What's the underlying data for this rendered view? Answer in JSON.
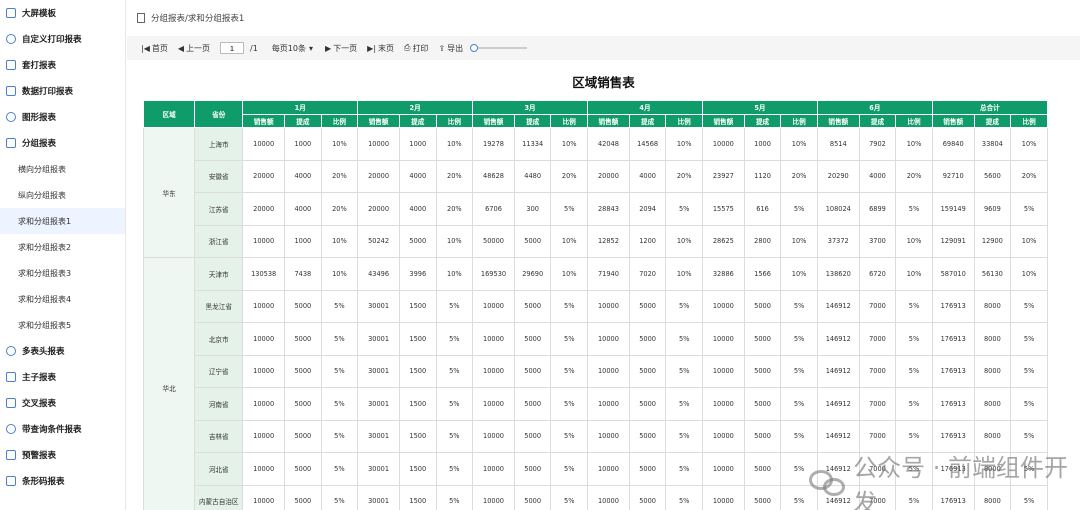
{
  "sidebar": {
    "items": [
      {
        "label": "大屏模板",
        "type": "top"
      },
      {
        "label": "自定义打印报表",
        "type": "top"
      },
      {
        "label": "套打报表",
        "type": "top"
      },
      {
        "label": "数据打印报表",
        "type": "top"
      },
      {
        "label": "图形报表",
        "type": "top"
      },
      {
        "label": "分组报表",
        "type": "top"
      },
      {
        "label": "横向分组报表",
        "type": "sub"
      },
      {
        "label": "纵向分组报表",
        "type": "sub"
      },
      {
        "label": "求和分组报表1",
        "type": "sub",
        "active": true
      },
      {
        "label": "求和分组报表2",
        "type": "sub"
      },
      {
        "label": "求和分组报表3",
        "type": "sub"
      },
      {
        "label": "求和分组报表4",
        "type": "sub"
      },
      {
        "label": "求和分组报表5",
        "type": "sub"
      },
      {
        "label": "多表头报表",
        "type": "top"
      },
      {
        "label": "主子报表",
        "type": "top"
      },
      {
        "label": "交叉报表",
        "type": "top"
      },
      {
        "label": "带查询条件报表",
        "type": "top"
      },
      {
        "label": "预警报表",
        "type": "top"
      },
      {
        "label": "条形码报表",
        "type": "top"
      }
    ]
  },
  "breadcrumb": "分组报表/求和分组报表1",
  "toolbar": {
    "first": "首页",
    "prev": "上一页",
    "page_value": "1",
    "total": "/1",
    "per_page": "每页10条",
    "next": "下一页",
    "last": "末页",
    "print": "打印",
    "export": "导出"
  },
  "report": {
    "title": "区域销售表",
    "col_region": "区域",
    "col_province": "省份",
    "months": [
      "1月",
      "2月",
      "3月",
      "4月",
      "5月",
      "6月",
      "总合计"
    ],
    "sub_headers": [
      "销售额",
      "提成",
      "比例"
    ],
    "groups": [
      {
        "region": "华东",
        "rows": [
          {
            "province": "上海市",
            "cells": [
              "10000",
              "1000",
              "10%",
              "10000",
              "1000",
              "10%",
              "19278",
              "11334",
              "10%",
              "42048",
              "14568",
              "10%",
              "10000",
              "1000",
              "10%",
              "8514",
              "7902",
              "10%",
              "69840",
              "33804",
              "10%"
            ]
          },
          {
            "province": "安徽省",
            "cells": [
              "20000",
              "4000",
              "20%",
              "20000",
              "4000",
              "20%",
              "48628",
              "4480",
              "20%",
              "20000",
              "4000",
              "20%",
              "23927",
              "1120",
              "20%",
              "20290",
              "4000",
              "20%",
              "92710",
              "5600",
              "20%"
            ]
          },
          {
            "province": "江苏省",
            "cells": [
              "20000",
              "4000",
              "20%",
              "20000",
              "4000",
              "20%",
              "6706",
              "300",
              "5%",
              "28843",
              "2094",
              "5%",
              "15575",
              "616",
              "5%",
              "108024",
              "6899",
              "5%",
              "159149",
              "9609",
              "5%"
            ]
          },
          {
            "province": "浙江省",
            "cells": [
              "10000",
              "1000",
              "10%",
              "50242",
              "5000",
              "10%",
              "50000",
              "5000",
              "10%",
              "12852",
              "1200",
              "10%",
              "28625",
              "2800",
              "10%",
              "37372",
              "3700",
              "10%",
              "129091",
              "12900",
              "10%"
            ]
          }
        ]
      },
      {
        "region": "华北",
        "rows": [
          {
            "province": "天津市",
            "cells": [
              "130538",
              "7438",
              "10%",
              "43496",
              "3996",
              "10%",
              "169530",
              "29690",
              "10%",
              "71940",
              "7020",
              "10%",
              "32886",
              "1566",
              "10%",
              "138620",
              "6720",
              "10%",
              "587010",
              "56130",
              "10%"
            ]
          },
          {
            "province": "黑龙江省",
            "cells": [
              "10000",
              "5000",
              "5%",
              "30001",
              "1500",
              "5%",
              "10000",
              "5000",
              "5%",
              "10000",
              "5000",
              "5%",
              "10000",
              "5000",
              "5%",
              "146912",
              "7000",
              "5%",
              "176913",
              "8000",
              "5%"
            ]
          },
          {
            "province": "北京市",
            "cells": [
              "10000",
              "5000",
              "5%",
              "30001",
              "1500",
              "5%",
              "10000",
              "5000",
              "5%",
              "10000",
              "5000",
              "5%",
              "10000",
              "5000",
              "5%",
              "146912",
              "7000",
              "5%",
              "176913",
              "8000",
              "5%"
            ]
          },
          {
            "province": "辽宁省",
            "cells": [
              "10000",
              "5000",
              "5%",
              "30001",
              "1500",
              "5%",
              "10000",
              "5000",
              "5%",
              "10000",
              "5000",
              "5%",
              "10000",
              "5000",
              "5%",
              "146912",
              "7000",
              "5%",
              "176913",
              "8000",
              "5%"
            ]
          },
          {
            "province": "河南省",
            "cells": [
              "10000",
              "5000",
              "5%",
              "30001",
              "1500",
              "5%",
              "10000",
              "5000",
              "5%",
              "10000",
              "5000",
              "5%",
              "10000",
              "5000",
              "5%",
              "146912",
              "7000",
              "5%",
              "176913",
              "8000",
              "5%"
            ]
          },
          {
            "province": "吉林省",
            "cells": [
              "10000",
              "5000",
              "5%",
              "30001",
              "1500",
              "5%",
              "10000",
              "5000",
              "5%",
              "10000",
              "5000",
              "5%",
              "10000",
              "5000",
              "5%",
              "146912",
              "7000",
              "5%",
              "176913",
              "8000",
              "5%"
            ]
          },
          {
            "province": "河北省",
            "cells": [
              "10000",
              "5000",
              "5%",
              "30001",
              "1500",
              "5%",
              "10000",
              "5000",
              "5%",
              "10000",
              "5000",
              "5%",
              "10000",
              "5000",
              "5%",
              "146912",
              "7000",
              "5%",
              "176913",
              "8000",
              "5%"
            ]
          },
          {
            "province": "内蒙古自治区",
            "cells": [
              "10000",
              "5000",
              "5%",
              "30001",
              "1500",
              "5%",
              "10000",
              "5000",
              "5%",
              "10000",
              "5000",
              "5%",
              "10000",
              "5000",
              "5%",
              "146912",
              "7000",
              "5%",
              "176913",
              "8000",
              "5%"
            ]
          }
        ]
      }
    ]
  },
  "watermark": "公众号 · 前端组件开发",
  "colors": {
    "header_green": "#0f9b6a",
    "accent_blue": "#4a7fd1"
  }
}
